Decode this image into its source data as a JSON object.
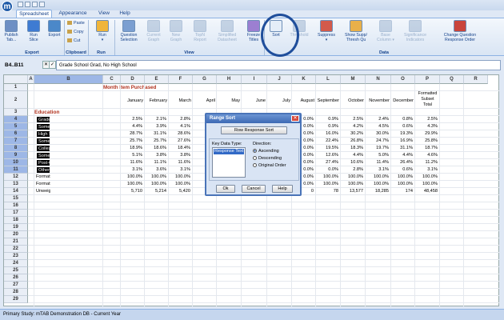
{
  "window": {
    "logo_letter": "m"
  },
  "tabs": [
    "Spreadsheet",
    "Appearance",
    "View",
    "Help"
  ],
  "ribbon": {
    "buttons": [
      {
        "label": "Publish\nTab...",
        "icon": "publish-icon",
        "color": "#6d8fc4",
        "disabled": false
      },
      {
        "label": "Run\nSlice",
        "icon": "run-slice-icon",
        "color": "#3e7bd2",
        "disabled": false
      },
      {
        "label": "Export",
        "icon": "export-icon",
        "color": "#4b88c9",
        "disabled": false
      },
      {
        "label": "Run\n▾",
        "icon": "run-icon",
        "color": "#f0b53a",
        "disabled": false
      },
      {
        "label": "Question\nSelection",
        "icon": "question-selection-icon",
        "color": "#7b9fd1",
        "disabled": false
      },
      {
        "label": "Current\nGraph",
        "icon": "current-graph-icon",
        "color": "#8fa9c9",
        "disabled": true
      },
      {
        "label": "New\nGraph",
        "icon": "new-graph-icon",
        "color": "#8fa9c9",
        "disabled": true
      },
      {
        "label": "TopN\nReport",
        "icon": "topn-report-icon",
        "color": "#8fa9c9",
        "disabled": true
      },
      {
        "label": "Simplified\nDatasheet",
        "icon": "simplified-datasheet-icon",
        "color": "#8fa9c9",
        "disabled": true
      },
      {
        "label": "Freeze\nTitles",
        "icon": "freeze-titles-icon",
        "color": "#9c7fd1",
        "disabled": false
      },
      {
        "label": "Sort",
        "icon": "sort-icon",
        "color": "#e4edf8",
        "disabled": false
      },
      {
        "label": "Threshold",
        "icon": "threshold-icon",
        "color": "#8fa9c9",
        "disabled": true
      },
      {
        "label": "Suppress\n▾",
        "icon": "suppress-icon",
        "color": "#d25a4b",
        "disabled": false
      },
      {
        "label": "Show Supp/\nThresh Qu",
        "icon": "show-supp-thresh-icon",
        "color": "#e8b04a",
        "disabled": false
      },
      {
        "label": "Base\nColumn ▾",
        "icon": "base-column-icon",
        "color": "#8fa9c9",
        "disabled": true
      },
      {
        "label": "Significance\nIndicators",
        "icon": "significance-indicators-icon",
        "color": "#8fa9c9",
        "disabled": true
      },
      {
        "label": "Change Question\nResponse Order",
        "icon": "change-response-order-icon",
        "color": "#c9443b",
        "disabled": false
      }
    ],
    "clipboard": [
      "Paste",
      "Copy",
      "Cut"
    ],
    "groups": [
      "Export",
      "Clipboard",
      "Run",
      "View",
      "Data"
    ]
  },
  "namebox": "B4..B11",
  "formula_icons": {
    "cancel": "✕",
    "confirm": "✓"
  },
  "formula": "Grade School Grad, No High School",
  "columns": [
    "A",
    "B",
    "C",
    "D",
    "E",
    "F",
    "G",
    "H",
    "I",
    "J",
    "K",
    "L",
    "M",
    "N",
    "O",
    "P",
    "Q",
    "R"
  ],
  "sheet": {
    "title": "Month Item Purchased",
    "months": [
      "January",
      "February",
      "March",
      "April",
      "May",
      "June",
      "July",
      "August",
      "September",
      "October",
      "November",
      "December"
    ],
    "formatted_subset_total": "Formatted\nSubset\nTotal",
    "section": "Education",
    "rows": [
      {
        "num": "1"
      },
      {
        "num": "2"
      },
      {
        "num": "3"
      },
      {
        "num": "4",
        "label": "Grade School Grad, No High School",
        "vals": [
          "2.5%",
          "2.1%",
          "2.8%",
          "",
          "",
          "",
          "",
          "0.0%",
          "0.9%",
          "2.5%",
          "2.4%",
          "0.8%",
          "2.5%"
        ]
      },
      {
        "num": "5",
        "label": "Some High School",
        "vals": [
          "4.4%",
          "3.9%",
          "4.1%",
          "",
          "",
          "",
          "",
          "0.0%",
          "0.9%",
          "4.2%",
          "4.5%",
          "0.6%",
          "4.3%"
        ]
      },
      {
        "num": "6",
        "label": "High School Graduate",
        "vals": [
          "28.7%",
          "31.1%",
          "28.6%",
          "",
          "",
          "",
          "",
          "0.0%",
          "16.0%",
          "30.2%",
          "30.0%",
          "19.3%",
          "29.9%"
        ]
      },
      {
        "num": "7",
        "label": "Some College",
        "vals": [
          "25.7%",
          "25.7%",
          "27.6%",
          "",
          "",
          "",
          "",
          "0.0%",
          "22.4%",
          "26.8%",
          "24.7%",
          "16.9%",
          "25.8%"
        ]
      },
      {
        "num": "8",
        "label": "College Graduate",
        "vals": [
          "18.9%",
          "18.6%",
          "18.4%",
          "",
          "",
          "",
          "",
          "0.0%",
          "19.5%",
          "18.3%",
          "19.7%",
          "31.1%",
          "18.7%"
        ]
      },
      {
        "num": "9",
        "label": "Some Post-Grad",
        "vals": [
          "5.1%",
          "3.8%",
          "3.8%",
          "",
          "",
          "",
          "",
          "0.0%",
          "12.6%",
          "4.4%",
          "5.0%",
          "4.4%",
          "4.6%"
        ]
      },
      {
        "num": "10",
        "label": "Post-Graduate Degree",
        "vals": [
          "11.6%",
          "11.1%",
          "11.6%",
          "",
          "",
          "",
          "",
          "0.0%",
          "27.4%",
          "10.6%",
          "11.4%",
          "26.4%",
          "11.2%"
        ]
      },
      {
        "num": "11",
        "label": "Other (Trade School)",
        "vals": [
          "3.1%",
          "3.6%",
          "3.1%",
          "",
          "",
          "",
          "",
          "0.0%",
          "0.0%",
          "2.8%",
          "3.1%",
          "0.6%",
          "3.1%"
        ]
      },
      {
        "num": "12",
        "label": "Formatted Subset Total",
        "vals": [
          "100.0%",
          "100.0%",
          "100.0%",
          "",
          "",
          "",
          "",
          "0.0%",
          "100.0%",
          "100.0%",
          "100.0%",
          "100.0%",
          "100.0%"
        ]
      },
      {
        "num": "13",
        "label": "Formatted Sample Total",
        "vals": [
          "100.0%",
          "100.0%",
          "100.0%",
          "",
          "",
          "",
          "",
          "0.0%",
          "100.0%",
          "100.0%",
          "100.0%",
          "100.0%",
          "100.0%"
        ]
      },
      {
        "num": "14",
        "label": "Unweighted Sample Total Count",
        "vals": [
          "5,710",
          "5,214",
          "5,420",
          "",
          "",
          "",
          "",
          "0",
          "78",
          "13,577",
          "18,285",
          "174",
          "48,458"
        ]
      },
      {
        "num": "15"
      },
      {
        "num": "16"
      },
      {
        "num": "17"
      },
      {
        "num": "18"
      },
      {
        "num": "19"
      },
      {
        "num": "20"
      },
      {
        "num": "21"
      },
      {
        "num": "22"
      },
      {
        "num": "23"
      },
      {
        "num": "24"
      },
      {
        "num": "25"
      },
      {
        "num": "26"
      },
      {
        "num": "27"
      },
      {
        "num": "28"
      },
      {
        "num": "29"
      }
    ]
  },
  "dialog": {
    "title": "Range Sort",
    "close": "✕",
    "subtitle": "Row Response Sort",
    "key_label": "Key Data Type:",
    "key_value": "Response Text",
    "direction_label": "Direction:",
    "options": [
      {
        "label": "Ascending",
        "selected": true
      },
      {
        "label": "Descending",
        "selected": false
      },
      {
        "label": "Original Order",
        "selected": false
      }
    ],
    "ok": "Ok",
    "cancel": "Cancel",
    "help": "Help"
  },
  "status": "Primary Study: mTAB Demonstration DB - Current Year"
}
